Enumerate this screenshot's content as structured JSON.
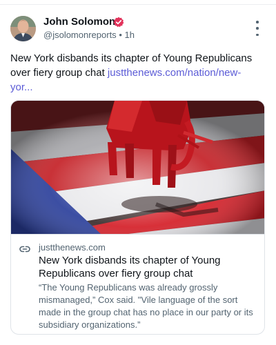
{
  "post": {
    "author_name": "John Solomon",
    "handle": "@jsolomonreports",
    "separator": "•",
    "time": "1h",
    "text": "New York disbands its chapter of Young Republicans over fiery group chat ",
    "link_text": "justthenews.com/nation/new-yor..."
  },
  "card": {
    "domain": "justthenews.com",
    "title": "New York disbands its chapter of Young Republicans over fiery group chat",
    "description": "“The Young Republicans was already grossly mismanaged,” Cox said. \"Vile language of the sort made in the group chat has no place in our party or its subsidiary organizations.”"
  },
  "icons": {
    "verified": "verified-badge-icon",
    "more": "more-options-icon",
    "link": "link-icon"
  },
  "colors": {
    "link": "#5b5bd6",
    "verified": "#e2335b",
    "text": "#0f1419",
    "muted": "#536471",
    "border": "#dfe3e8"
  }
}
